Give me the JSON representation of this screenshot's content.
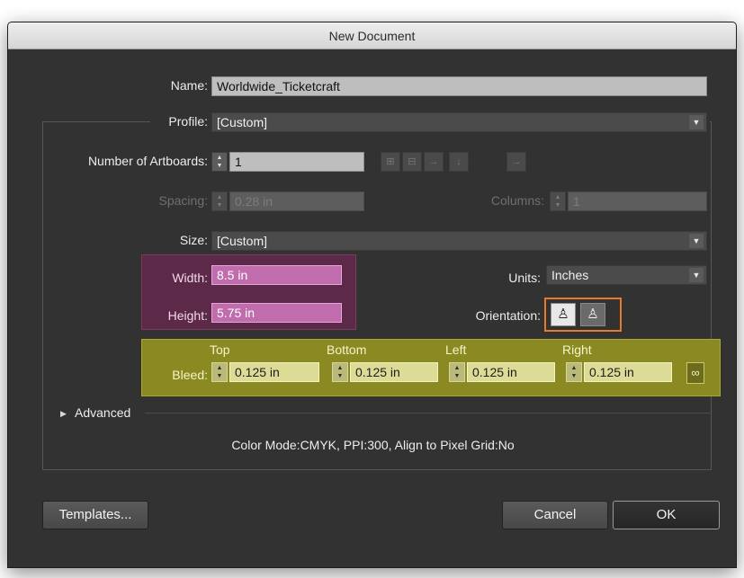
{
  "dialog": {
    "title": "New Document",
    "name_label": "Name:",
    "name_value": "Worldwide_Ticketcraft",
    "profile_label": "Profile:",
    "profile_value": "[Custom]",
    "artboards_label": "Number of Artboards:",
    "artboards_value": "1",
    "spacing_label": "Spacing:",
    "spacing_value": "0.28 in",
    "columns_label": "Columns:",
    "columns_value": "1",
    "size_label": "Size:",
    "size_value": "[Custom]",
    "width_label": "Width:",
    "width_value": "8.5 in",
    "height_label": "Height:",
    "height_value": "5.75 in",
    "units_label": "Units:",
    "units_value": "Inches",
    "orientation_label": "Orientation:",
    "bleed": {
      "label": "Bleed:",
      "top_label": "Top",
      "bottom_label": "Bottom",
      "left_label": "Left",
      "right_label": "Right",
      "top": "0.125 in",
      "bottom": "0.125 in",
      "left": "0.125 in",
      "right": "0.125 in"
    },
    "advanced_label": "Advanced",
    "info_text": "Color Mode:CMYK, PPI:300, Align to Pixel Grid:No",
    "buttons": {
      "templates": "Templates...",
      "cancel": "Cancel",
      "ok": "OK"
    }
  },
  "colors": {
    "dialog_bg": "#323232",
    "width_height_highlight": "#5c2a48",
    "bleed_highlight": "#8b8a22",
    "orientation_highlight": "#e8792e"
  },
  "icons": {
    "arrange_artboards": [
      "grid-by-row-icon",
      "grid-by-column-icon",
      "arrange-by-row-icon",
      "arrange-by-column-icon",
      "right-to-left-layout-icon"
    ],
    "orientation": [
      "portrait-icon",
      "landscape-icon"
    ],
    "bleed_link": "link-icon",
    "advanced_toggle": "disclosure-triangle-icon"
  }
}
